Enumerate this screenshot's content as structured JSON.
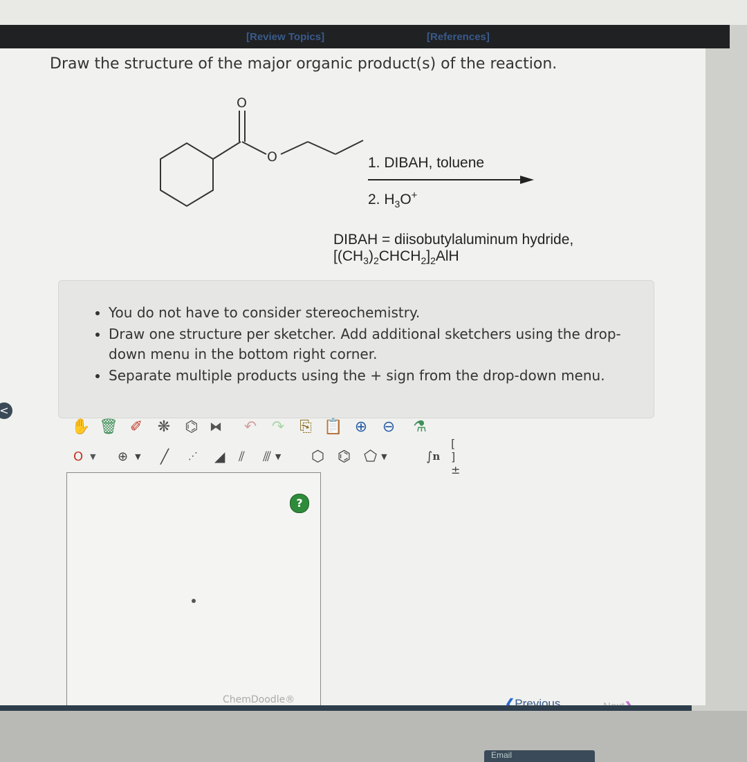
{
  "header": {
    "review_topics": "[Review Topics]",
    "references": "[References]"
  },
  "question": "Draw the structure of the major organic product(s) of the reaction.",
  "molecule": {
    "carbonyl_o": "O",
    "ester_o": "O"
  },
  "reagents": {
    "step1": "1. DIBAH, toluene",
    "step2_prefix": "2. H",
    "step2_sub": "3",
    "step2_mid": "O",
    "step2_sup": "+"
  },
  "dibah_definition": {
    "line1": "DIBAH = diisobutylaluminum hydride,",
    "line2_a": "[(CH",
    "line2_b": "3",
    "line2_c": ")",
    "line2_d": "2",
    "line2_e": "CHCH",
    "line2_f": "2",
    "line2_g": "]",
    "line2_h": "2",
    "line2_i": "AlH"
  },
  "instructions": [
    "You do not have to consider stereochemistry.",
    "Draw one structure per sketcher. Add additional sketchers using the drop-down menu in the bottom right corner.",
    "Separate multiple products using the + sign from the drop-down menu."
  ],
  "toolbar": {
    "atom_selector": "O",
    "charge_selector": "⊕",
    "sn_label": "n",
    "bracket_label": "[ ]±"
  },
  "sketcher": {
    "help": "?",
    "brand": "ChemDoodle®"
  },
  "nav": {
    "previous": "Previous",
    "next": "Next"
  },
  "footer": {
    "email": "Email"
  },
  "side_handle": "<"
}
